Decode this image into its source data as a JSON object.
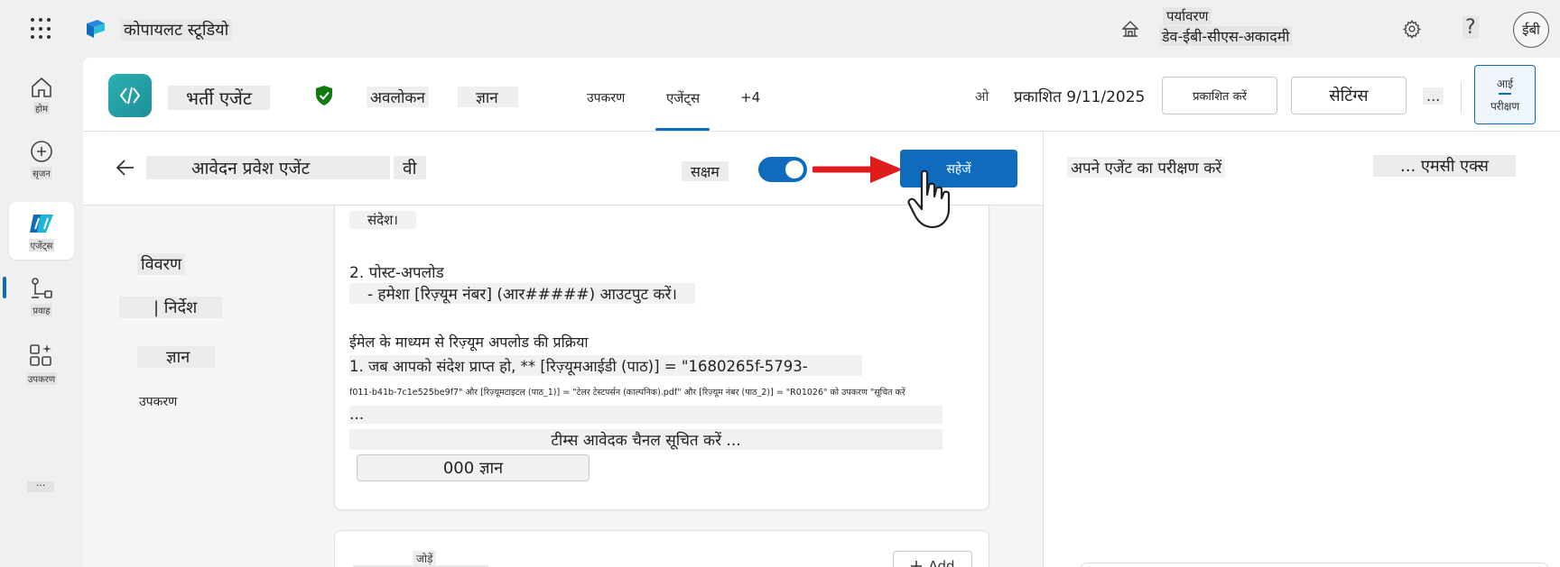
{
  "topbar": {
    "app_name": "कोपायलट स्टूडियो",
    "env_label": "पर्यावरण",
    "env_value": "डेव-ईबी-सीएस-अकादमी",
    "help": "?",
    "avatar_initials": "ईबी"
  },
  "rail": {
    "items": [
      {
        "label": "होम",
        "icon": "home-icon"
      },
      {
        "label": "सृजन",
        "icon": "plus-circle-icon"
      },
      {
        "label": "एजेंट्स",
        "icon": "agents-icon"
      },
      {
        "label": "प्रवाह",
        "icon": "flows-icon"
      },
      {
        "label": "उपकरण",
        "icon": "tools-icon"
      }
    ],
    "more": "···"
  },
  "agentbar": {
    "agent_name": "भर्ती एजेंट",
    "tabs": [
      {
        "label": "अवलोकन"
      },
      {
        "label": "ज्ञान"
      },
      {
        "label": "उपकरण"
      },
      {
        "label": "एजेंट्स"
      },
      {
        "label": "+4"
      }
    ],
    "published_icon": "ओ",
    "published_text": "प्रकाशित 9/11/2025",
    "publish_button": "प्रकाशित करें",
    "settings_button": "सेटिंग्स",
    "more": "...",
    "test_button_line1": "आई",
    "test_button_line2": "परीक्षण"
  },
  "subheader": {
    "title": "आवेदन प्रवेश एजेंट",
    "title_suffix": "वी",
    "enabled_label": "सक्षम",
    "enabled": true,
    "save_button": "सहेजें"
  },
  "side_nav": {
    "items": [
      "विवरण",
      "| निर्देश",
      "ज्ञान",
      "उपकरण"
    ]
  },
  "instructions": {
    "lines": [
      "संदेश।",
      "2. पोस्ट-अपलोड",
      "  - हमेशा [रिज़्यूम नंबर] (आर#####) आउटपुट करें।",
      "ईमेल के माध्यम से रिज़्यूम अपलोड की प्रक्रिया",
      "1. जब आपको संदेश प्राप्त हो, ** [रिज़्यूमआईडी (पाठ)] = \"1680265f-5793-",
      "f011-b41b-7c1e525be9f7\" और [रिज़्यूमटाइटल (पाठ_1)] = \"टेलर टेस्टपर्सन (काल्पनिक).pdf\" और [रिज़्यूम नंबर (पाठ_2)] = \"R01026\" को उपकरण \"सूचित करें",
      "...",
      "टीम्स आवेदक चैनल सूचित करें ..."
    ],
    "knowledge_chip": "000 ज्ञान"
  },
  "bottom_card": {
    "label": "जोड़ें",
    "add_button": "Add"
  },
  "test_panel": {
    "title": "अपने एजेंट का परीक्षण करें",
    "right_label": "... एमसी एक्स"
  },
  "colors": {
    "accent": "#0f6cbd",
    "agent_icon": "#2bb1b0",
    "shield": "#107c10",
    "arrow": "#e01b1b"
  }
}
